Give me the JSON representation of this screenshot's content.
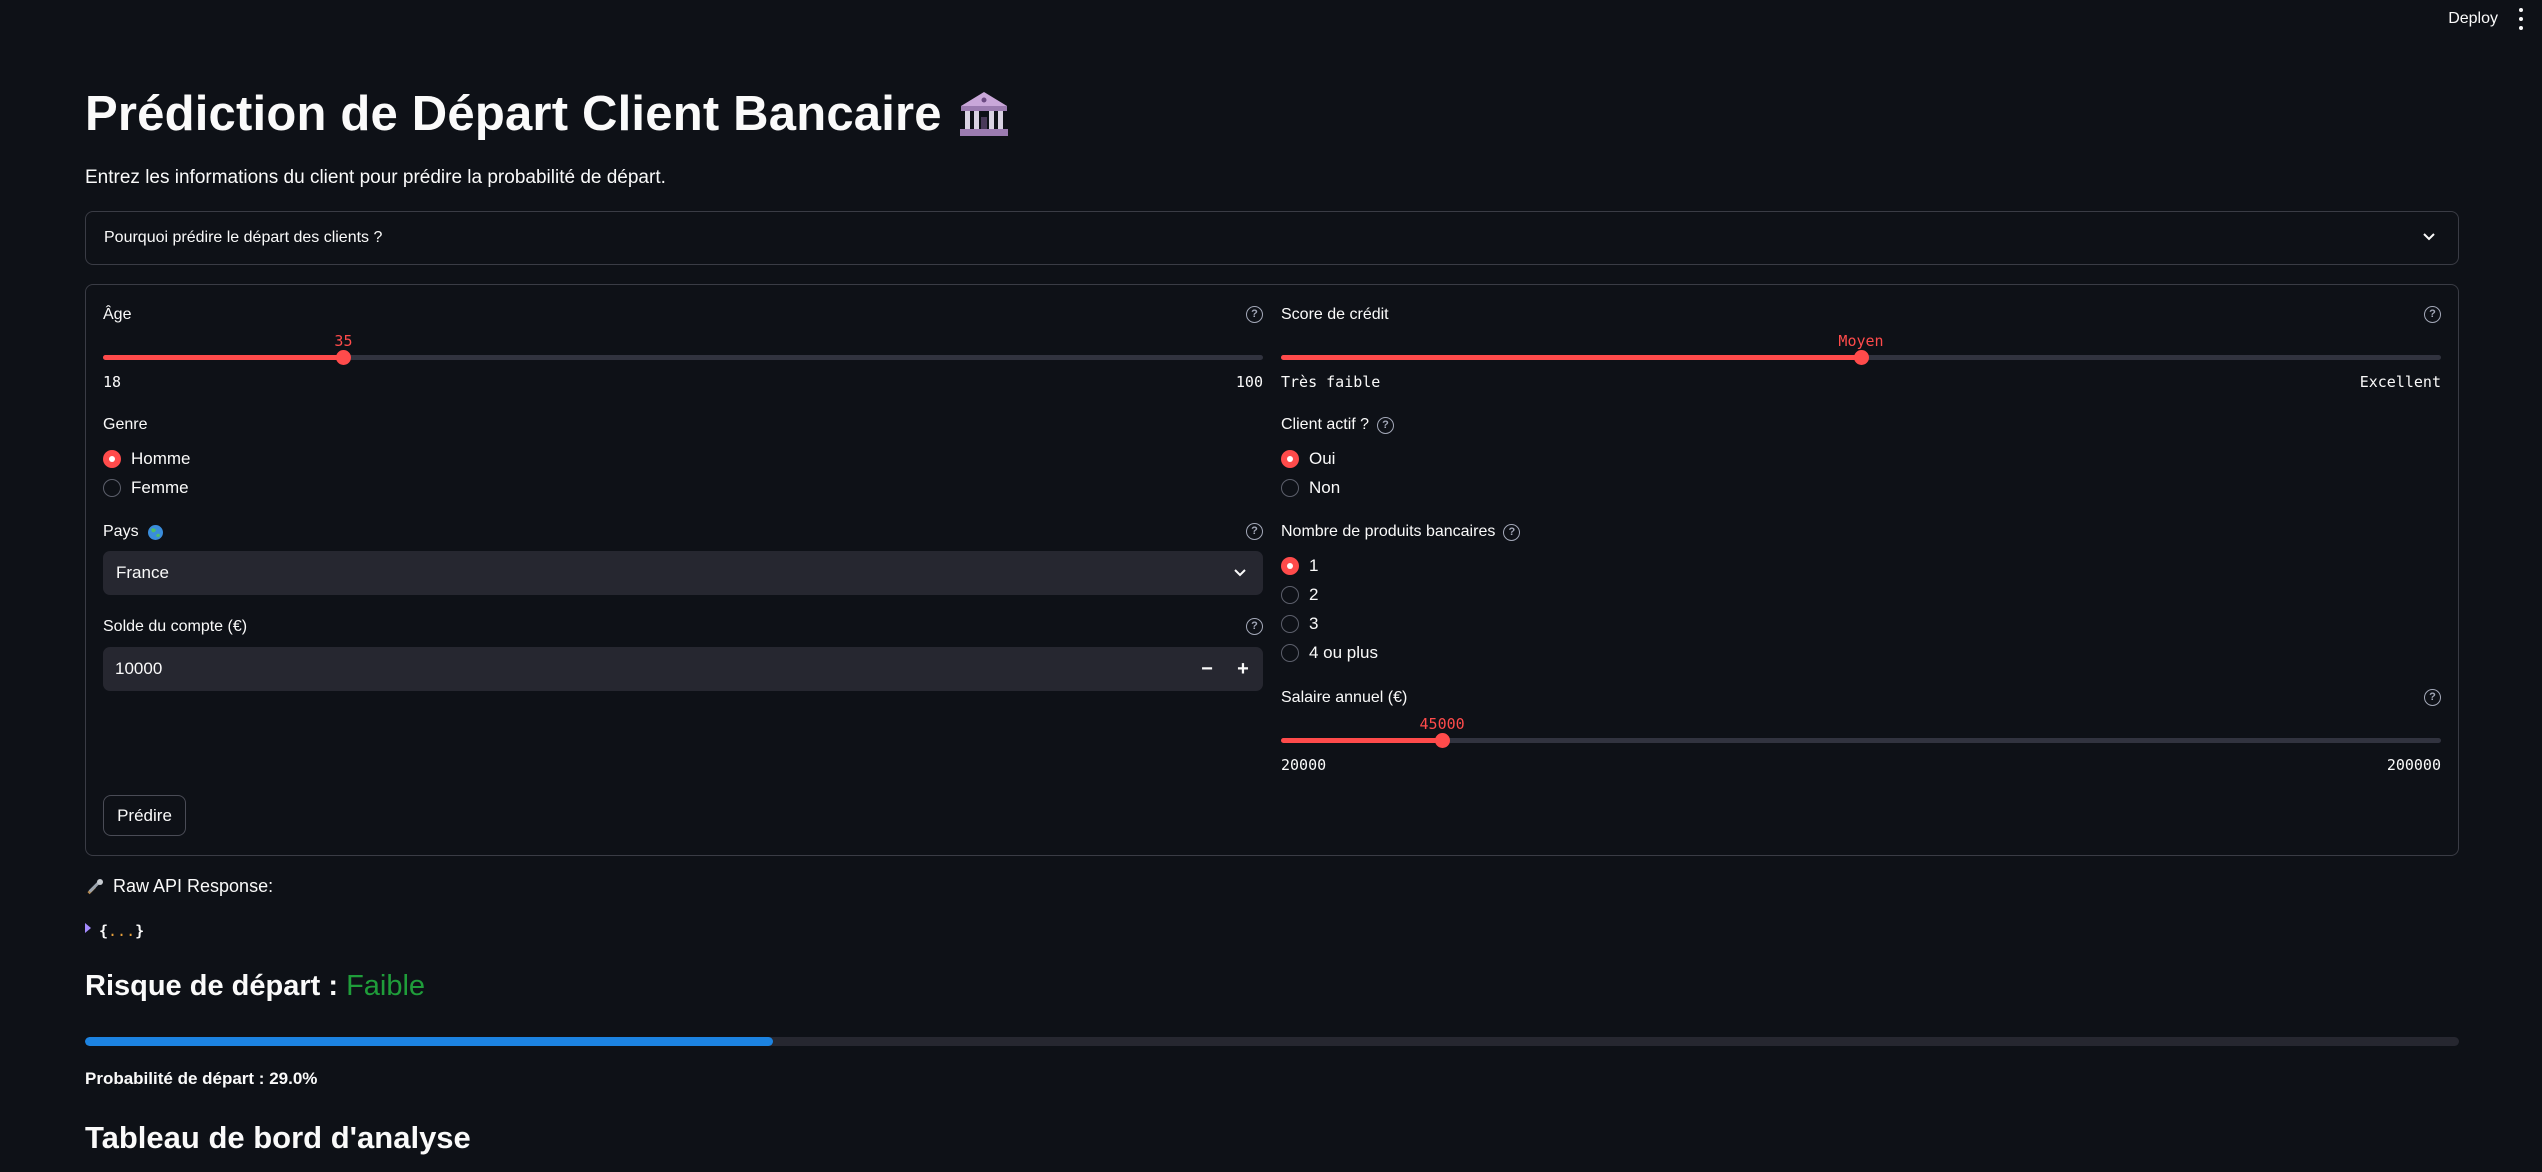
{
  "header": {
    "deploy_label": "Deploy"
  },
  "page": {
    "title": "Prédiction de Départ Client Bancaire",
    "subtitle": "Entrez les informations du client pour prédire la probabilité de départ."
  },
  "expander": {
    "label": "Pourquoi prédire le départ des clients ?"
  },
  "form": {
    "age": {
      "label": "Âge",
      "value": "35",
      "min": "18",
      "max": "100",
      "fraction": 0.2073
    },
    "credit_score": {
      "label": "Score de crédit",
      "value": "Moyen",
      "min": "Très faible",
      "max": "Excellent",
      "fraction": 0.5
    },
    "gender": {
      "label": "Genre",
      "options": [
        "Homme",
        "Femme"
      ],
      "selected": "Homme"
    },
    "active": {
      "label": "Client actif ?",
      "options": [
        "Oui",
        "Non"
      ],
      "selected": "Oui"
    },
    "country": {
      "label": "Pays",
      "value": "France"
    },
    "products": {
      "label": "Nombre de produits bancaires",
      "options": [
        "1",
        "2",
        "3",
        "4 ou plus"
      ],
      "selected": "1"
    },
    "balance": {
      "label": "Solde du compte (€)",
      "value": "10000",
      "minus": "−",
      "plus": "+"
    },
    "salary": {
      "label": "Salaire annuel (€)",
      "value": "45000",
      "min": "20000",
      "max": "200000",
      "fraction": 0.1389
    },
    "submit_label": "Prédire"
  },
  "raw": {
    "title": "Raw API Response:",
    "json_open": "{",
    "json_dots": "...",
    "json_close": "}"
  },
  "result": {
    "risk_prefix": "Risque de départ :",
    "risk_level": "Faible",
    "risk_color": "#1f9d3a",
    "probability": 0.29,
    "probability_text": "Probabilité de départ : 29.0%"
  },
  "dashboard": {
    "title": "Tableau de bord d'analyse"
  },
  "colors": {
    "accent": "#ff4b4b",
    "progress": "#1c83e1",
    "background": "#0e1117"
  }
}
